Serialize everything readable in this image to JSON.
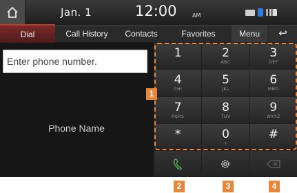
{
  "status_bar": {
    "date": "Jan.  1",
    "time": "12:00",
    "ampm": "AM"
  },
  "tabs": {
    "dial": "Dial",
    "call_history": "Call History",
    "contacts": "Contacts",
    "favorites": "Favorites",
    "menu": "Menu",
    "back": "↩"
  },
  "input": {
    "placeholder": "Enter phone number."
  },
  "phone_name": "Phone Name",
  "keypad": [
    {
      "digit": "1",
      "sub": ""
    },
    {
      "digit": "2",
      "sub": "ABC"
    },
    {
      "digit": "3",
      "sub": "DEF"
    },
    {
      "digit": "4",
      "sub": "GHI"
    },
    {
      "digit": "5",
      "sub": "JKL"
    },
    {
      "digit": "6",
      "sub": "MNO"
    },
    {
      "digit": "7",
      "sub": "PQRS"
    },
    {
      "digit": "8",
      "sub": "TUV"
    },
    {
      "digit": "9",
      "sub": "WXYZ"
    },
    {
      "digit": "*",
      "sub": ""
    },
    {
      "digit": "0",
      "sub": "+"
    },
    {
      "digit": "#",
      "sub": ""
    }
  ],
  "actions": {
    "call_icon": "phone-handset-icon",
    "settings_icon": "gear-icon",
    "delete_icon": "backspace-icon"
  },
  "callouts": [
    "1",
    "2",
    "3",
    "4"
  ],
  "colors": {
    "accent_tab": "#c0392b",
    "callout": "#e8863a",
    "call_green": "#4caf50"
  }
}
